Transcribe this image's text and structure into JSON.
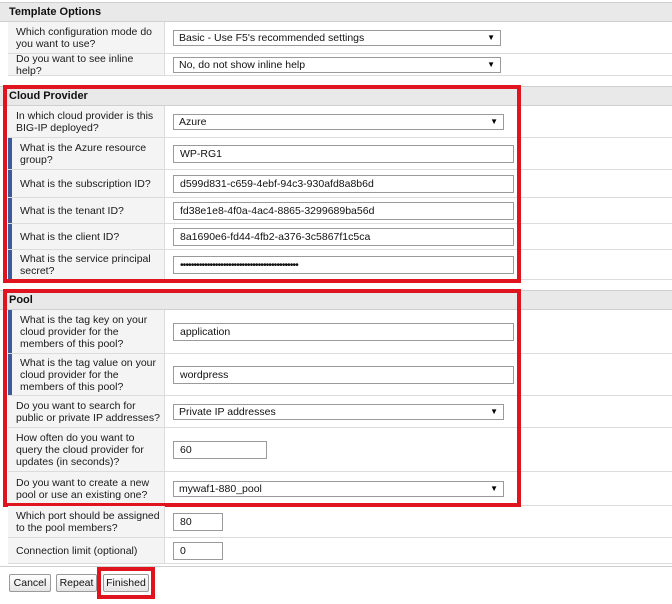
{
  "template_options": {
    "title": "Template Options",
    "config_mode": {
      "label": "Which configuration mode do you want to use?",
      "value": "Basic - Use F5's recommended settings"
    },
    "inline_help": {
      "label": "Do you want to see inline help?",
      "value": "No, do not show inline help"
    }
  },
  "cloud_provider": {
    "title": "Cloud Provider",
    "provider": {
      "label": "In which cloud provider is this BIG-IP deployed?",
      "value": "Azure"
    },
    "resource_group": {
      "label": "What is the Azure resource group?",
      "value": "WP-RG1"
    },
    "subscription_id": {
      "label": "What is the subscription ID?",
      "value": "d599d831-c659-4ebf-94c3-930afd8a8b6d"
    },
    "tenant_id": {
      "label": "What is the tenant ID?",
      "value": "fd38e1e8-4f0a-4ac4-8865-3299689ba56d"
    },
    "client_id": {
      "label": "What is the client ID?",
      "value": "8a1690e6-fd44-4fb2-a376-3c5867f1c5ca"
    },
    "principal_secret": {
      "label": "What is the service principal secret?",
      "value": "••••••••••••••••••••••••••••••••••••••••••••"
    }
  },
  "pool": {
    "title": "Pool",
    "tag_key": {
      "label": "What is the tag key on your cloud provider for the members of this pool?",
      "value": "application"
    },
    "tag_value": {
      "label": "What is the tag value on your cloud provider for the members of this pool?",
      "value": "wordpress"
    },
    "ip_search": {
      "label": "Do you want to search for public or private IP addresses?",
      "value": "Private IP addresses"
    },
    "query_interval": {
      "label": "How often do you want to query the cloud provider for updates (in seconds)?",
      "value": "60"
    },
    "pool_choice": {
      "label": "Do you want to create a new pool or use an existing one?",
      "value": "mywaf1-880_pool"
    },
    "member_port": {
      "label": "Which port should be assigned to the pool members?",
      "value": "80"
    },
    "connection_limit": {
      "label": "Connection limit (optional)",
      "value": "0"
    }
  },
  "buttons": {
    "cancel": "Cancel",
    "repeat": "Repeat",
    "finished": "Finished"
  },
  "colors": {
    "highlight": "#e0141e",
    "required_marker": "#3b5a99"
  }
}
